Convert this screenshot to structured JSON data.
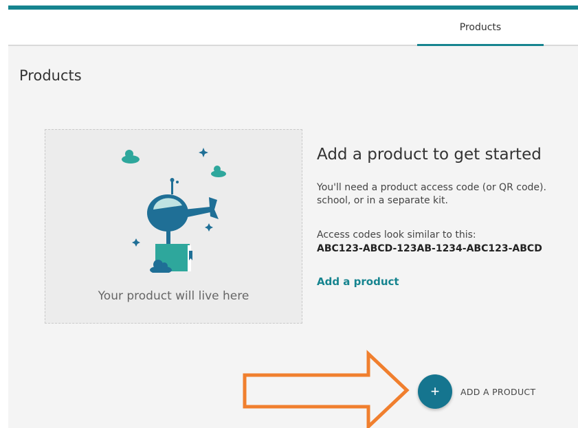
{
  "nav": {
    "tab_products": "Products"
  },
  "page": {
    "title": "Products"
  },
  "placeholder": {
    "caption": "Your product will live here"
  },
  "content": {
    "heading": "Add a product to get started",
    "paragraph": "You'll need a product access code (or QR code). school, or in a separate kit.",
    "codes_label": "Access codes look similar to this:",
    "codes_example": "ABC123-ABCD-123AB-1234-ABC123-ABCD",
    "add_link": "Add a product"
  },
  "fab": {
    "icon": "plus-icon",
    "symbol": "+",
    "label": "ADD A PRODUCT"
  },
  "colors": {
    "accent": "#16848f",
    "fab": "#15758f",
    "arrow": "#f07f2e",
    "illustration_blue": "#1f6f96",
    "illustration_teal": "#2ea79c"
  }
}
